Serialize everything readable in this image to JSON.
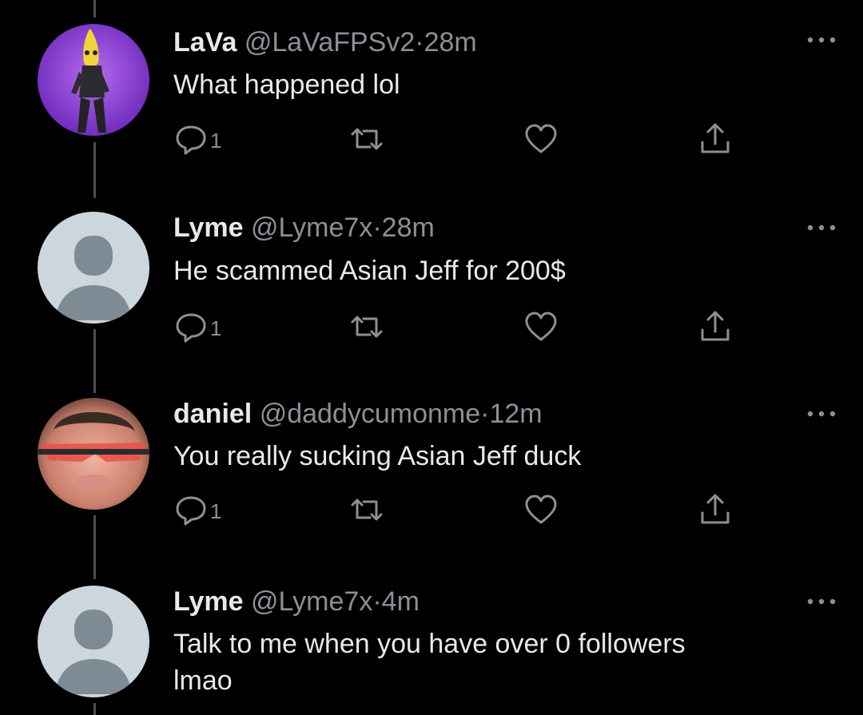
{
  "tweets": [
    {
      "name": "LaVa",
      "handle": "@LaVaFPSv2",
      "separator": "·",
      "time": "28m",
      "text": "What happened lol",
      "reply_count": "1",
      "avatar": "banana-character-avatar"
    },
    {
      "name": "Lyme",
      "handle": "@Lyme7x",
      "separator": "·",
      "time": "28m",
      "text": "He scammed Asian Jeff for 200$",
      "reply_count": "1",
      "avatar": "default-avatar"
    },
    {
      "name": "daniel",
      "handle": "@daddycumonme",
      "separator": "·",
      "time": "12m",
      "text": "You really sucking Asian Jeff duck",
      "reply_count": "1",
      "avatar": "photo-avatar"
    },
    {
      "name": "Lyme",
      "handle": "@Lyme7x",
      "separator": "·",
      "time": "4m",
      "text": "Talk to me when you have over 0 followers\nlmao",
      "reply_count": "",
      "avatar": "default-avatar"
    }
  ],
  "colors": {
    "background": "#000000",
    "text": "#e7e9ea",
    "secondary": "#8b9096",
    "thread_line": "#4a4d51"
  },
  "icons": [
    "reply-icon",
    "retweet-icon",
    "like-icon",
    "share-icon",
    "more-options-icon"
  ]
}
